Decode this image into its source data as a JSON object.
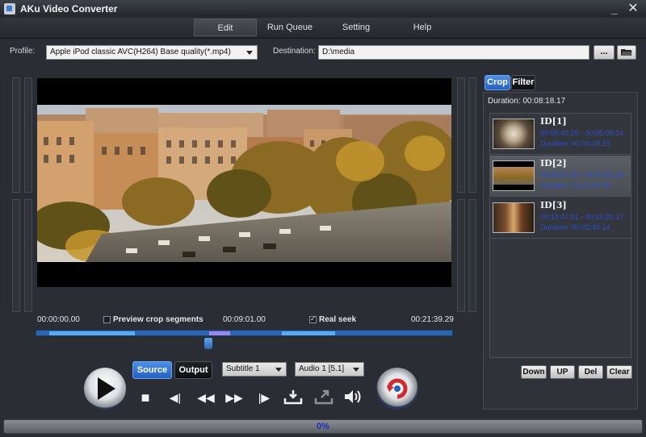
{
  "window": {
    "title": "AKu Video Converter",
    "min_glyph": "_",
    "close_glyph": "✕"
  },
  "menu": {
    "items": [
      "Edit",
      "Run Queue",
      "Setting",
      "Help"
    ],
    "active": "Edit"
  },
  "profile": {
    "label": "Profile:",
    "value": "Apple iPod classic AVC(H264) Base quality(*.mp4)",
    "destination_label": "Destination:",
    "destination_value": "D:\\media",
    "browse_label": "...",
    "folder_icon": "folder-open-icon"
  },
  "player": {
    "time_start": "00:00:00.00",
    "time_current": "00:09:01.00",
    "time_end": "00:21:39.29",
    "preview_crop_label": "Preview crop segments",
    "preview_crop_checked": false,
    "real_seek_label": "Real seek",
    "real_seek_checked": true,
    "source_label": "Source",
    "output_label": "Output",
    "subtitle_value": "Subtitle 1",
    "audio_value": "Audio 1 [5.1]",
    "play_glyph": "▶",
    "stop_glyph": "■",
    "step_back_glyph": "◀|",
    "rewind_glyph": "◀◀",
    "forward_glyph": "▶▶",
    "step_forward_glyph": "|▶",
    "mark_in_glyph": "⇩",
    "mark_out_glyph": "⇗",
    "volume_glyph": "🔊"
  },
  "crop_panel": {
    "tabs": [
      "Crop",
      "Filter"
    ],
    "active_tab": "Crop",
    "duration_label": "Duration:",
    "duration_value": "00:08:18.17",
    "segments": [
      {
        "id": "ID[1]",
        "range": "00:00:40.29 - 00:05:09.14",
        "duration": "Duration: 00:04:28.13",
        "selected": false
      },
      {
        "id": "ID[2]",
        "range": "00:09:01.00 - 00:10:05.18",
        "duration": "Duration: 00:01:04.18",
        "selected": true
      },
      {
        "id": "ID[3]",
        "range": "00:12:47.01 - 00:15:32.17",
        "duration": "Duration: 00:02:45.14",
        "selected": false
      }
    ],
    "buttons": {
      "down": "Down",
      "up": "UP",
      "del": "Del",
      "clear": "Clear"
    }
  },
  "progress": {
    "percent_text": "0%",
    "fraction": 0.0
  },
  "colors": {
    "accent": "#3a7bd5",
    "segment": "#5aaaf0",
    "selected_segment": "#9a88e8",
    "id_text": "#2d4fd0"
  }
}
